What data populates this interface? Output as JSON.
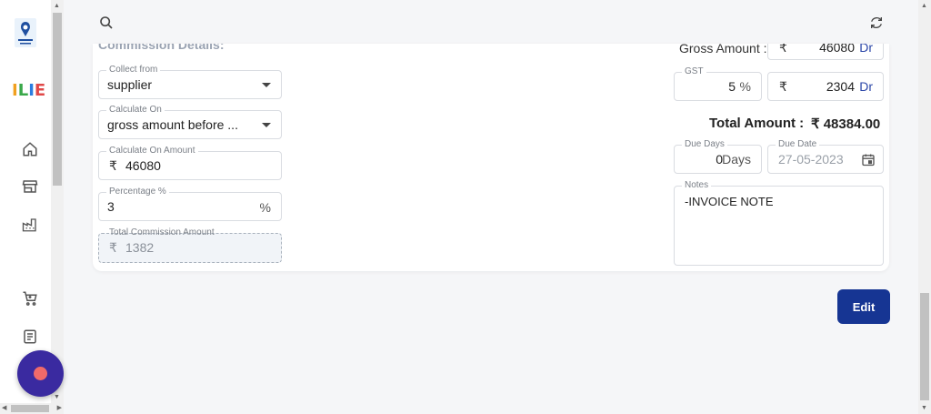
{
  "sidebar": {
    "logo_text": "ILIE",
    "items": [
      {
        "icon": "home-icon"
      },
      {
        "icon": "store-icon"
      },
      {
        "icon": "factory-icon"
      },
      {
        "icon": "cart-icon"
      },
      {
        "icon": "document-icon"
      }
    ]
  },
  "topbar": {
    "search_icon": "search-icon",
    "refresh_icon": "refresh-icon"
  },
  "commission": {
    "section_title": "Commission Details:",
    "collect_from": {
      "label": "Collect from",
      "value": "supplier"
    },
    "calculate_on": {
      "label": "Calculate On",
      "value": "gross amount before ..."
    },
    "calculate_on_amount": {
      "label": "Calculate On Amount",
      "currency": "₹",
      "value": "46080"
    },
    "percentage": {
      "label": "Percentage %",
      "value": "3",
      "suffix": "%"
    },
    "total_commission": {
      "label": "Total Commission Amount",
      "currency": "₹",
      "value": "1382"
    }
  },
  "summary": {
    "gross_amount": {
      "label": "Gross Amount :",
      "currency": "₹",
      "value": "46080",
      "type": "Dr"
    },
    "gst": {
      "label": "GST",
      "percent": "5",
      "percent_suffix": "%",
      "currency": "₹",
      "value": "2304",
      "type": "Dr"
    },
    "total": {
      "label": "Total Amount :",
      "value": "₹ 48384.00"
    },
    "due_days": {
      "label": "Due Days",
      "value": "0",
      "suffix": "Days"
    },
    "due_date": {
      "label": "Due Date",
      "value": "27-05-2023"
    },
    "notes": {
      "label": "Notes",
      "value": "-INVOICE NOTE"
    }
  },
  "actions": {
    "edit_label": "Edit"
  },
  "colors": {
    "primary": "#163593",
    "fab": "#3a2aa0",
    "fab_dot": "#f06a6a",
    "dr_text": "#2b46a8"
  }
}
